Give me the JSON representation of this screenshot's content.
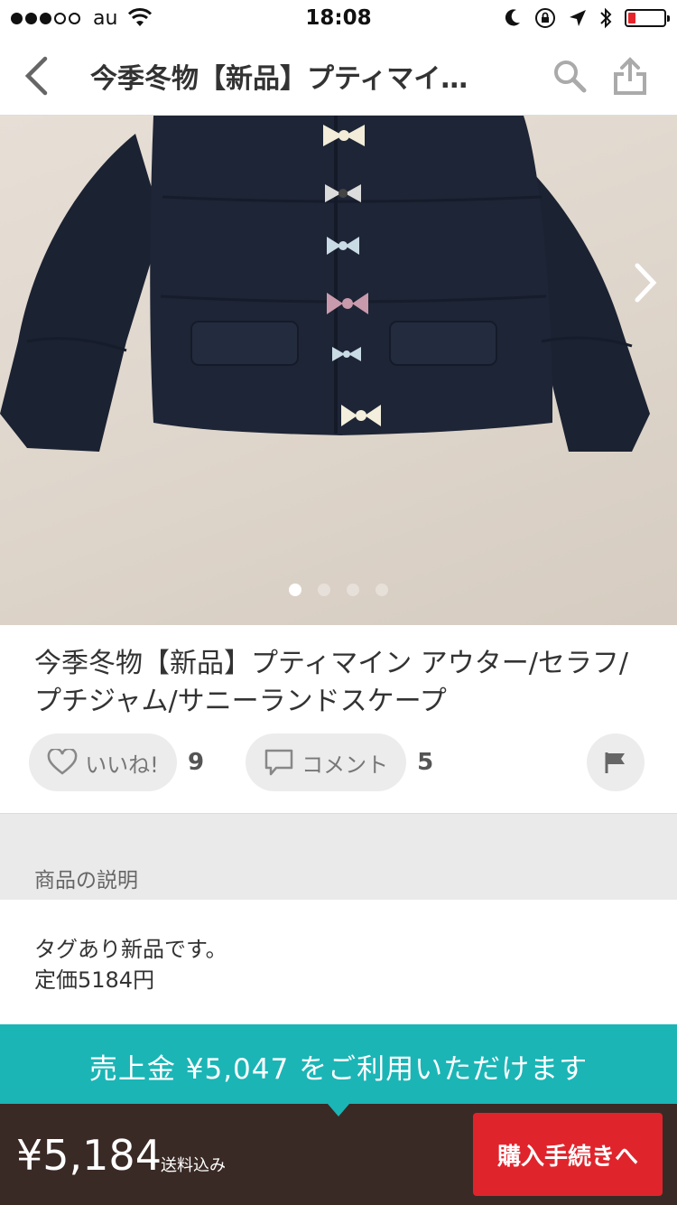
{
  "status_bar": {
    "carrier": "au",
    "time": "18:08",
    "signal_bars_filled": 3,
    "signal_bars_total": 5,
    "battery_level_fraction": 0.15,
    "icons": [
      "wifi-icon",
      "moon-icon",
      "rotation-lock-icon",
      "location-arrow-icon",
      "bluetooth-icon",
      "battery-icon"
    ]
  },
  "nav": {
    "title": "今季冬物【新品】プティマイ…",
    "icons": [
      "chevron-left-icon",
      "search-icon",
      "share-icon"
    ]
  },
  "photo": {
    "slide_count": 4,
    "active_slide": 1
  },
  "item": {
    "title": "今季冬物【新品】プティマイン アウター/セラフ/プチジャム/サニーランドスケープ",
    "like_label": "いいね!",
    "like_count": "9",
    "comment_label": "コメント",
    "comment_count": "5"
  },
  "description": {
    "heading": "商品の説明",
    "line1": "タグあり新品です。",
    "line2": "定価5184円"
  },
  "banner": {
    "text": "売上金 ¥5,047 をご利用いただけます"
  },
  "purchase": {
    "price": "¥5,184",
    "shipping_note": "送料込み",
    "buy_button": "購入手続きへ"
  },
  "colors": {
    "banner": "#1bb5b6",
    "buy_bar": "#3a2a25",
    "buy_button": "#e0242c",
    "battery_low": "#e6242b"
  }
}
